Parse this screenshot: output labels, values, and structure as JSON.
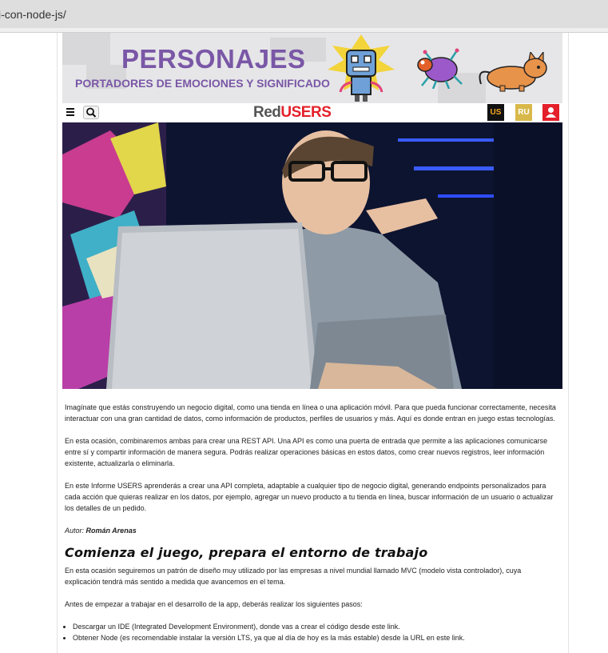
{
  "browser": {
    "url_fragment": "i-con-node-js/"
  },
  "banner": {
    "title": "PERSONAJES",
    "subtitle": "PORTADORES DE EMOCIONES Y SIGNIFICADO"
  },
  "nav": {
    "logo_red": "Red",
    "logo_users": "USERS",
    "badge_us": "US",
    "badge_ru": "RU"
  },
  "article": {
    "p1": "Imagínate que estás construyendo un negocio digital, como una tienda en línea o una aplicación móvil. Para que pueda funcionar correctamente, necesita interactuar con una gran cantidad de datos, como información de productos, perfiles de usuarios y más. Aquí es donde entran en juego estas tecnologías.",
    "p2": "En esta ocasión, combinaremos ambas para crear una REST API. Una API es como una puerta de entrada que permite a las aplicaciones comunicarse entre sí y compartir información de manera segura. Podrás realizar operaciones básicas en estos datos, como crear nuevos registros, leer información existente, actualizarla o eliminarla.",
    "p3": "En este Informe USERS aprenderás a crear una API completa, adaptable a cualquier tipo de negocio digital, generando endpoints personalizados para cada acción que quieras realizar en los datos, por ejemplo, agregar un nuevo producto a tu tienda en línea, buscar información de un usuario o actualizar los detalles de un pedido.",
    "author_label": "Autor: ",
    "author_name": "Román Arenas",
    "heading": "Comienza el juego, prepara el entorno de trabajo",
    "p4": "En esta ocasión seguiremos un patrón de diseño muy utilizado por las empresas a nivel mundial llamado MVC (modelo vista controlador), cuya explicación tendrá más sentido a medida que avancemos en el tema.",
    "p5": "Antes de empezar a trabajar en el desarrollo de la app, deberás realizar los siguientes pasos:",
    "steps": [
      "Descargar un IDE (Integrated Development Environment), donde vas a crear el código desde este link.",
      "Obtener Node (es recomendable instalar la versión LTS, ya que al día de hoy es la más estable) desde la URL en este link."
    ]
  }
}
